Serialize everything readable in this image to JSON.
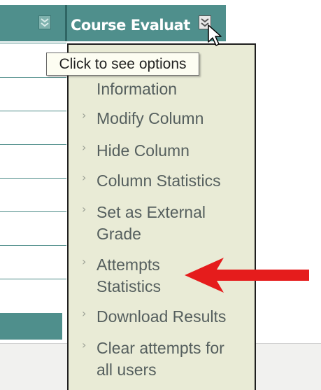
{
  "header": {
    "column_title": "Course Evaluat"
  },
  "tooltip": {
    "text": "Click to see options"
  },
  "menu": {
    "items": [
      {
        "label": "Information"
      },
      {
        "label": "Modify Column"
      },
      {
        "label": "Hide Column"
      },
      {
        "label": "Column Statistics"
      },
      {
        "label": "Set as External Grade",
        "lines": [
          "Set as External",
          "Grade"
        ]
      },
      {
        "label": "Attempts Statistics",
        "lines": [
          "Attempts",
          "Statistics"
        ]
      },
      {
        "label": "Download Results"
      },
      {
        "label": "Clear attempts for all users",
        "lines": [
          "Clear attempts for",
          "all users"
        ]
      }
    ]
  },
  "colors": {
    "header_teal": "#4f8f8c",
    "menu_bg": "#e9ebd6",
    "menu_text": "#555f5e",
    "annotation_arrow": "#e51c1c"
  },
  "icons": {
    "column_options": "chevron-double-down-icon",
    "cursor": "mouse-pointer-icon",
    "annotation": "red-arrow-icon"
  }
}
